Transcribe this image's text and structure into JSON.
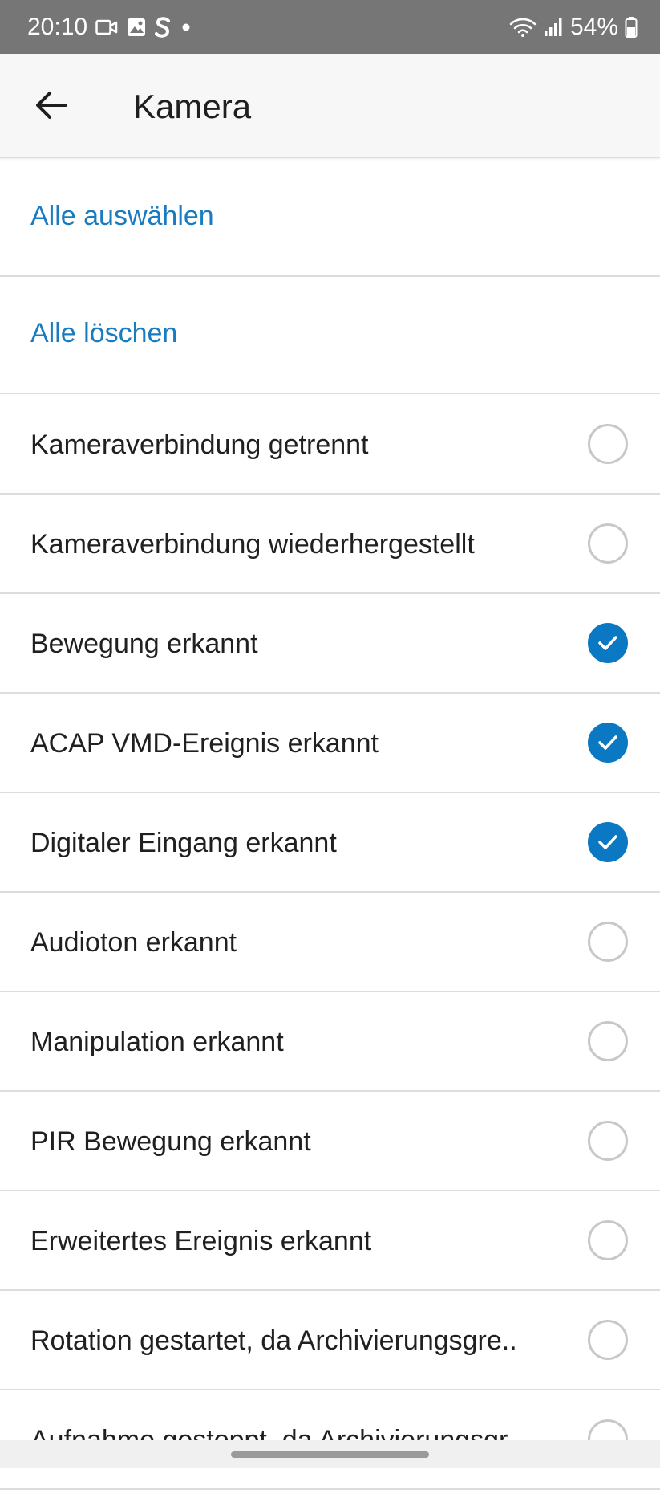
{
  "status_bar": {
    "time": "20:10",
    "battery": "54%",
    "icons": [
      "video-record-icon",
      "image-icon",
      "s-app-icon",
      "dot-icon",
      "wifi-icon",
      "signal-icon",
      "battery-icon"
    ]
  },
  "app_bar": {
    "title": "Kamera",
    "back_icon": "arrow-left-icon"
  },
  "actions": [
    {
      "label": "Alle auswählen"
    },
    {
      "label": "Alle löschen"
    }
  ],
  "events": [
    {
      "label": "Kameraverbindung getrennt",
      "checked": false
    },
    {
      "label": "Kameraverbindung wiederhergestellt",
      "checked": false
    },
    {
      "label": "Bewegung erkannt",
      "checked": true
    },
    {
      "label": "ACAP VMD-Ereignis erkannt",
      "checked": true
    },
    {
      "label": "Digitaler Eingang erkannt",
      "checked": true
    },
    {
      "label": "Audioton erkannt",
      "checked": false
    },
    {
      "label": "Manipulation erkannt",
      "checked": false
    },
    {
      "label": "PIR Bewegung erkannt",
      "checked": false
    },
    {
      "label": "Erweitertes Ereignis erkannt",
      "checked": false
    },
    {
      "label": "Rotation gestartet, da Archivierungsgre..",
      "checked": false
    },
    {
      "label": "Aufnahme gestoppt, da Archivierungsgr..",
      "checked": false
    }
  ],
  "colors": {
    "accent": "#0a78c2",
    "link": "#1a7cc0",
    "status_bar": "#767676"
  }
}
